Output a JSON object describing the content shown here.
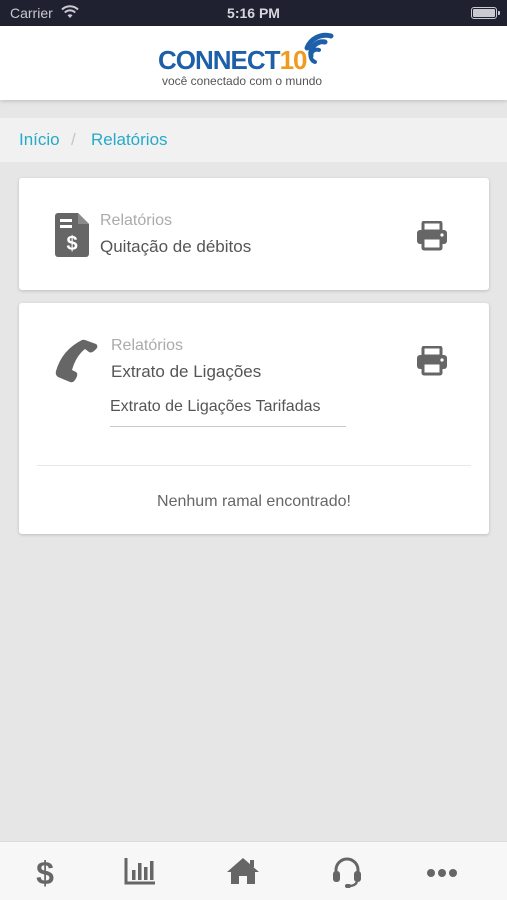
{
  "status_bar": {
    "carrier": "Carrier",
    "time": "5:16 PM"
  },
  "header": {
    "logo": {
      "brand_a": "CONNECT",
      "brand_b": "10",
      "tagline": "você conectado com o mundo"
    }
  },
  "breadcrumb": {
    "home": "Início",
    "separator": "/",
    "current": "Relatórios"
  },
  "reports": [
    {
      "label": "Relatórios",
      "title": "Quitação de débitos",
      "icon": "document-dollar-icon"
    },
    {
      "label": "Relatórios",
      "title": "Extrato de Ligações",
      "icon": "phone-icon",
      "select_value": "Extrato de Ligações Tarifadas",
      "empty_message": "Nenhum ramal encontrado!"
    }
  ],
  "tabbar": [
    "dollar-icon",
    "bar-chart-icon",
    "home-icon",
    "headset-icon",
    "more-icon"
  ],
  "colors": {
    "link": "#27a9c9",
    "brand_blue": "#1d5fa8",
    "brand_orange": "#f29a1f",
    "icon_gray": "#666666"
  }
}
